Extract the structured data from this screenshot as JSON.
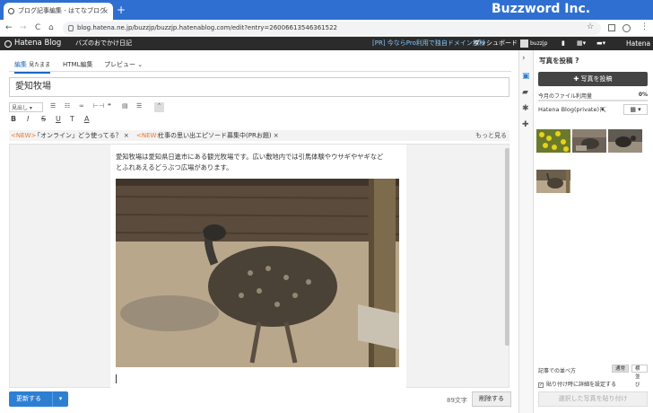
{
  "browser": {
    "tab_title": "ブログ記事編集 - はてなブログ",
    "tab_close": "×",
    "new_tab": "+",
    "brand": "Buzzword Inc.",
    "url": "blog.hatena.ne.jp/buzzjp/buzzjp.hatenablog.com/edit?entry=26006613546361522",
    "back": "←",
    "forward": "→",
    "reload": "C",
    "home": "⌂",
    "star": "☆",
    "menu": "⋮"
  },
  "header": {
    "logo": "Hatena Blog",
    "blog_name": "バズのおでかけ日記",
    "promo": "[PR] 今ならPro利用で独自ドメイン無料",
    "dashboard": "ダッシュボード",
    "user": "buzzjp",
    "hatena": "Hatena"
  },
  "editor": {
    "tabs": [
      {
        "label": "編集",
        "sub": "見たまま"
      },
      {
        "label": "HTML編集"
      },
      {
        "label": "プレビュー"
      }
    ],
    "title": "愛知牧場",
    "format_select": "見出し",
    "toolbar_row2": [
      "B",
      "I",
      "S",
      "U",
      "T",
      "A"
    ],
    "news": [
      {
        "tag": "<NEW>",
        "text": "「オンライン」どう使ってる？ ×"
      },
      {
        "tag": "<NEW>",
        "text": "仕事の思い出エピソード募集中(PRお題) ×"
      }
    ],
    "news_more": "もっと見る",
    "body_text": "愛知牧場は愛知県日進市にある観光牧場です。広い敷地内では引馬体験やウサギやヤギなどとふれあえるどうぶつ広場があります。",
    "char_count": "89文字",
    "update_label": "更新する",
    "delete_label": "削除する"
  },
  "sidebar": {
    "title": "写真を投稿",
    "post_button": "✚ 写真を投稿",
    "usage_label": "今月のファイル利用量",
    "usage_percent": "0%",
    "usage_fraction": 0.0,
    "album": "Hatena Blog(private) ▾",
    "sort_label": "記事での並べ方",
    "sort_options": [
      "通常",
      "横並び"
    ],
    "detail_check": "貼り付け時に詳細を設定する",
    "detail_checked": true,
    "paste_button": "選択した写真を貼り付け"
  }
}
